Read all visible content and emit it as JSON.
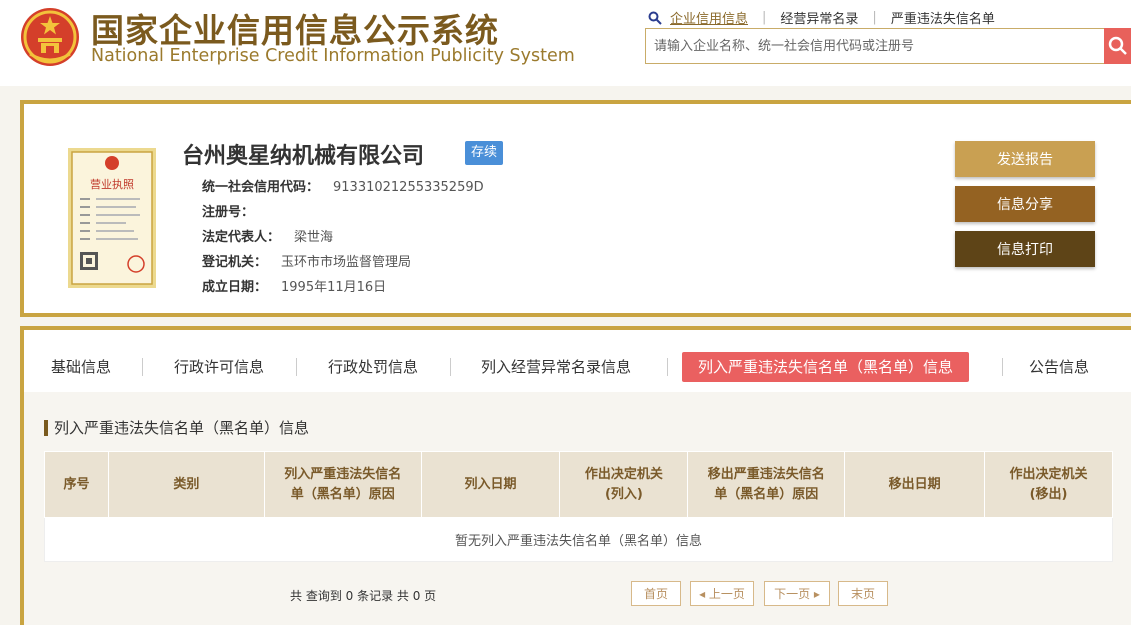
{
  "header": {
    "title_cn": "国家企业信用信息公示系统",
    "title_en": "National Enterprise Credit Information Publicity System",
    "links": [
      "企业信用信息",
      "经营异常名录",
      "严重违法失信名单"
    ],
    "search_placeholder": "请输入企业名称、统一社会信用代码或注册号"
  },
  "company": {
    "name": "台州奥星纳机械有限公司",
    "status": "存续",
    "license_title": "营业执照",
    "fields": [
      {
        "label": "统一社会信用代码：",
        "value": "91331021255335259D"
      },
      {
        "label": "注册号：",
        "value": ""
      },
      {
        "label": "法定代表人：",
        "value": "梁世海"
      },
      {
        "label": "登记机关：",
        "value": "玉环市市场监督管理局"
      },
      {
        "label": "成立日期：",
        "value": "1995年11月16日"
      }
    ],
    "buttons": [
      "发送报告",
      "信息分享",
      "信息打印"
    ]
  },
  "tabs": [
    "基础信息",
    "行政许可信息",
    "行政处罚信息",
    "列入经营异常名录信息",
    "列入严重违法失信名单（黑名单）信息",
    "公告信息"
  ],
  "section": {
    "title": "列入严重违法失信名单（黑名单）信息",
    "columns": [
      [
        "序号"
      ],
      [
        "类别"
      ],
      [
        "列入严重违法失信名",
        "单（黑名单）原因"
      ],
      [
        "列入日期"
      ],
      [
        "作出决定机关",
        "(列入)"
      ],
      [
        "移出严重违法失信名",
        "单（黑名单）原因"
      ],
      [
        "移出日期"
      ],
      [
        "作出决定机关",
        "(移出)"
      ]
    ],
    "empty_text": "暂无列入严重违法失信名单（黑名单）信息"
  },
  "pager": {
    "summary": "共 查询到 0 条记录 共 0 页",
    "first": "首页",
    "prev": "上一页",
    "next": "下一页",
    "last": "末页"
  },
  "colors": {
    "gold_border": "#c9a441",
    "btn_send": "#c9a052",
    "btn_share": "#946222",
    "btn_print": "#5e4417",
    "status_blue": "#4a8fd8",
    "tab_active": "#ea6060",
    "search_btn": "#e8615b"
  },
  "icons": [
    "national-emblem",
    "search-icon",
    "business-license-image",
    "chevron-left-icon",
    "chevron-right-icon"
  ]
}
